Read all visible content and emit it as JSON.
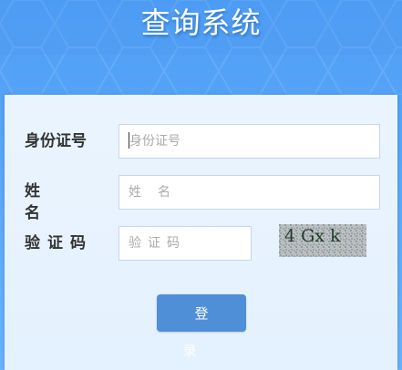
{
  "header": {
    "title": "查询系统"
  },
  "form": {
    "id_label": "身份证号",
    "id_placeholder": "身份证号",
    "name_label": "姓名",
    "name_placeholder": "姓名",
    "code_label": "验证码",
    "code_placeholder": "验证码",
    "captcha_text": "4 Gx k"
  },
  "actions": {
    "login_label": "登录"
  },
  "colors": {
    "background": "#5aa7f8",
    "panel": "#e8f3fe",
    "button": "#4e8fd8"
  }
}
